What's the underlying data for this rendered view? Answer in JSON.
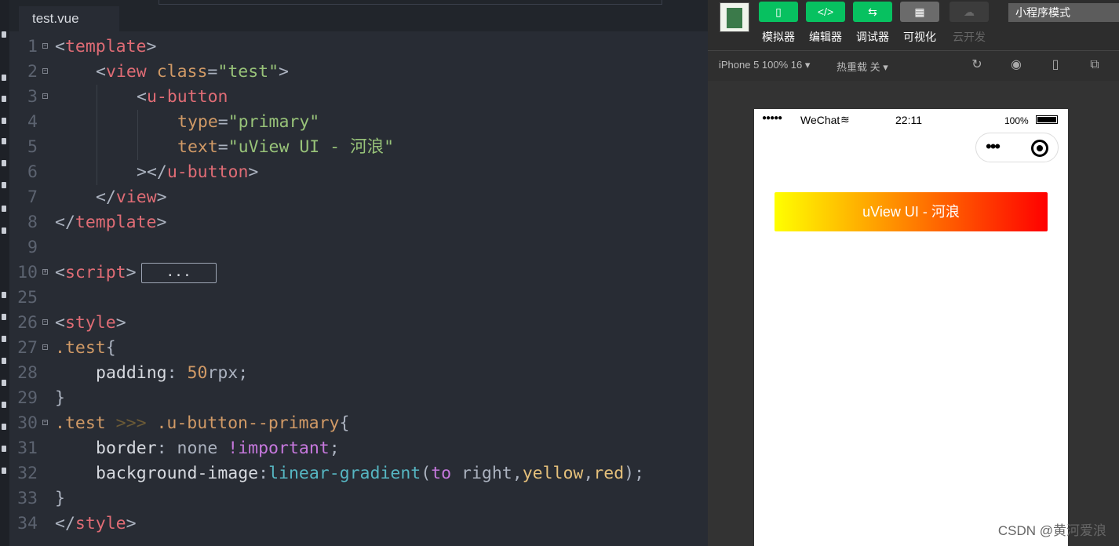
{
  "editor": {
    "tab": "test.vue",
    "lines": [
      {
        "n": "1",
        "fold": "−",
        "indent": 0,
        "guides": [],
        "tokens": [
          [
            "p",
            "<"
          ],
          [
            "tg",
            "template"
          ],
          [
            "p",
            ">"
          ]
        ]
      },
      {
        "n": "2",
        "fold": "−",
        "indent": 1,
        "guides": [],
        "tokens": [
          [
            "p",
            "<"
          ],
          [
            "tg",
            "view"
          ],
          [
            "p",
            " "
          ],
          [
            "at",
            "class"
          ],
          [
            "p",
            "="
          ],
          [
            "st",
            "\"test\""
          ],
          [
            "p",
            ">"
          ]
        ]
      },
      {
        "n": "3",
        "fold": "−",
        "indent": 2,
        "guides": [
          1
        ],
        "tokens": [
          [
            "p",
            "<"
          ],
          [
            "tg",
            "u-button"
          ]
        ]
      },
      {
        "n": "4",
        "fold": "",
        "indent": 3,
        "guides": [
          1,
          2
        ],
        "tokens": [
          [
            "at",
            "type"
          ],
          [
            "p",
            "="
          ],
          [
            "st",
            "\"primary\""
          ]
        ]
      },
      {
        "n": "5",
        "fold": "",
        "indent": 3,
        "guides": [
          1,
          2
        ],
        "tokens": [
          [
            "at",
            "text"
          ],
          [
            "p",
            "="
          ],
          [
            "st",
            "\"uView UI - 河浪\""
          ]
        ]
      },
      {
        "n": "6",
        "fold": "",
        "indent": 2,
        "guides": [
          1
        ],
        "tokens": [
          [
            "p",
            "></"
          ],
          [
            "tg",
            "u-button"
          ],
          [
            "p",
            ">"
          ]
        ]
      },
      {
        "n": "7",
        "fold": "",
        "indent": 1,
        "guides": [],
        "tokens": [
          [
            "p",
            "</"
          ],
          [
            "tg",
            "view"
          ],
          [
            "p",
            ">"
          ]
        ]
      },
      {
        "n": "8",
        "fold": "",
        "indent": 0,
        "guides": [],
        "tokens": [
          [
            "p",
            "</"
          ],
          [
            "tg",
            "template"
          ],
          [
            "p",
            ">"
          ]
        ]
      },
      {
        "n": "9",
        "fold": "",
        "indent": 0,
        "guides": [],
        "tokens": []
      },
      {
        "n": "10",
        "fold": "+",
        "indent": 0,
        "guides": [],
        "tokens": [
          [
            "p",
            "<"
          ],
          [
            "tg",
            "script"
          ],
          [
            "p",
            ">"
          ]
        ],
        "collapsed": "..."
      },
      {
        "n": "25",
        "fold": "",
        "indent": 0,
        "guides": [],
        "tokens": []
      },
      {
        "n": "26",
        "fold": "−",
        "indent": 0,
        "guides": [],
        "tokens": [
          [
            "p",
            "<"
          ],
          [
            "tg",
            "style"
          ],
          [
            "p",
            ">"
          ]
        ]
      },
      {
        "n": "27",
        "fold": "−",
        "indent": 0,
        "guides": [],
        "tokens": [
          [
            "sel",
            ".test"
          ],
          [
            "p",
            "{"
          ]
        ]
      },
      {
        "n": "28",
        "fold": "",
        "indent": 1,
        "guides": [],
        "tokens": [
          [
            "prop",
            "padding"
          ],
          [
            "p",
            ": "
          ],
          [
            "num",
            "50"
          ],
          [
            "p",
            "rpx;"
          ]
        ]
      },
      {
        "n": "29",
        "fold": "",
        "indent": 0,
        "guides": [],
        "tokens": [
          [
            "p",
            "}"
          ]
        ]
      },
      {
        "n": "30",
        "fold": "−",
        "indent": 0,
        "guides": [],
        "tokens": [
          [
            "sel",
            ".test"
          ],
          [
            "dim",
            " >>> "
          ],
          [
            "sel",
            ".u-button--primary"
          ],
          [
            "p",
            "{"
          ]
        ]
      },
      {
        "n": "31",
        "fold": "",
        "indent": 1,
        "guides": [],
        "tokens": [
          [
            "prop",
            "border"
          ],
          [
            "p",
            ": none "
          ],
          [
            "kw",
            "!important"
          ],
          [
            "p",
            ";"
          ]
        ]
      },
      {
        "n": "32",
        "fold": "",
        "indent": 1,
        "guides": [],
        "tokens": [
          [
            "prop",
            "background-image"
          ],
          [
            "p",
            ":"
          ],
          [
            "fn",
            "linear-gradient"
          ],
          [
            "p",
            "("
          ],
          [
            "kw",
            "to"
          ],
          [
            "p",
            " right,"
          ],
          [
            "yl",
            "yellow"
          ],
          [
            "p",
            ","
          ],
          [
            "yl",
            "red"
          ],
          [
            "p",
            ");"
          ]
        ]
      },
      {
        "n": "33",
        "fold": "",
        "indent": 0,
        "guides": [],
        "tokens": [
          [
            "p",
            "}"
          ]
        ]
      },
      {
        "n": "34",
        "fold": "",
        "indent": 0,
        "guides": [],
        "tokens": [
          [
            "p",
            "</"
          ],
          [
            "tg",
            "style"
          ],
          [
            "p",
            ">"
          ]
        ]
      }
    ]
  },
  "toolbar": {
    "buttons": [
      {
        "label": "模拟器",
        "icon": "phone-icon",
        "glyph": "▯",
        "color": "#07c160"
      },
      {
        "label": "编辑器",
        "icon": "code-icon",
        "glyph": "</>",
        "color": "#07c160"
      },
      {
        "label": "调试器",
        "icon": "debug-icon",
        "glyph": "⇆",
        "color": "#07c160"
      },
      {
        "label": "可视化",
        "icon": "layout-icon",
        "glyph": "▦",
        "color": "#6b6b6b"
      },
      {
        "label": "云开发",
        "icon": "cloud-icon",
        "glyph": "☁",
        "color": "#3c3c3c"
      }
    ],
    "mode": "小程序模式"
  },
  "subbar": {
    "device": "iPhone 5 100% 16 ▾",
    "hotreload": "热重载 关 ▾"
  },
  "phone": {
    "signal": "●●●●●",
    "carrier": "WeChat",
    "wifi": "≋",
    "time": "22:11",
    "battery": "100%",
    "capsule_dots": "•••",
    "button_text": "uView UI - 河浪"
  },
  "watermark": "CSDN @黄河爱浪"
}
